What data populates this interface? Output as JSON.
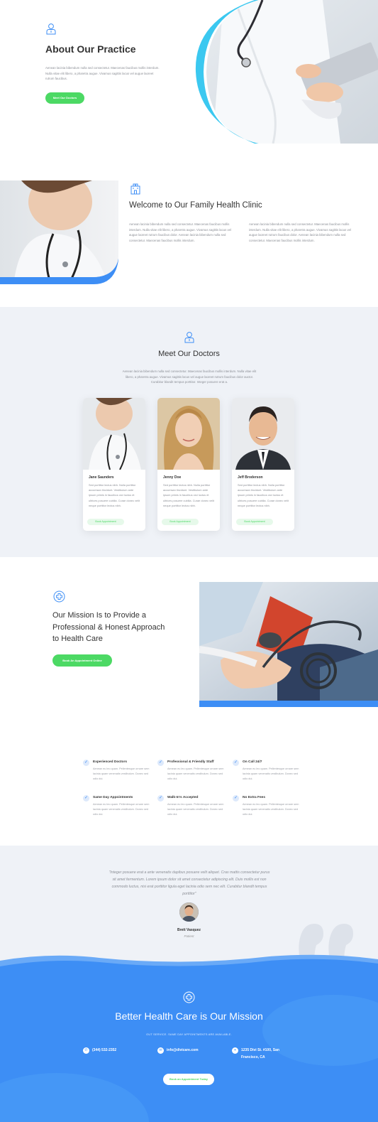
{
  "about": {
    "title": "About Our Practice",
    "text": "Aenean lacinia bibendum nulla sed consectetur. Maecenas faucibus mollis interdum. Nulla vitae elit libero, a pharetra augue. Vivamus sagittis lacus vel augue laoreet rutrum faucibus.",
    "button": "Meet Our Doctors",
    "icon": "doctor-icon"
  },
  "welcome": {
    "title": "Welcome to Our Family Health Clinic",
    "col1": "Aenean lacinia bibendum nulla sed consectetur. Maecenas faucibus mollis interdum. Nulla vitae elit libero, a pharetra augue. Vivamus sagittis lacus vel augue laoreet rutrum faucibus dolor. Aenean lacinia bibendum nulla sed consectetur. Maecenas faucibus mollis interdum.",
    "col2": "Aenean lacinia bibendum nulla sed consectetur. Maecenas faucibus mollis interdum. Nulla vitae elit libero, a pharetra augue. Vivamus sagittis lacus vel augue laoreet rutrum faucibus dolor. Aenean lacinia bibendum nulla sed consectetur. Maecenas faucibus mollis interdum.",
    "icon": "hospital-icon"
  },
  "doctors": {
    "title": "Meet Our Doctors",
    "intro": "Aenean lacinia bibendum nulla sed consectetur. Maecenas faucibus mollis interdum. Nulla vitae elit libero, a pharetra augue. Vivamus sagittis lacus vel augue laoreet rutrum faucibus dolor auctor. Curabitur blandit tempus porttitor. Integer posuere erat a.",
    "cards": [
      {
        "name": "Jane Saunders",
        "bio": "Sed porttitor lectus nibh. Nulla porttitor accumsan tincidunt. Vestibulum ante ipsum primis in faucibus orci luctus et ultrices posuere cubilia. Curae donec velit neque porttitor lectus nibh.",
        "button": "Book Appointment"
      },
      {
        "name": "Jenny Doe",
        "bio": "Sed porttitor lectus nibh. Nulla porttitor accumsan tincidunt. Vestibulum ante ipsum primis in faucibus orci luctus et ultrices posuere cubilia. Curae donec velit neque porttitor lectus nibh.",
        "button": "Book Appointment"
      },
      {
        "name": "Jeff Broderson",
        "bio": "Sed porttitor lectus nibh. Nulla porttitor accumsan tincidunt. Vestibulum ante ipsum primis in faucibus orci luctus et ultrices posuere cubilia. Curae donec velit neque porttitor lectus nibh.",
        "button": "Book Appointment"
      }
    ]
  },
  "mission": {
    "title": "Our Mission Is to Provide a Professional & Honest Approach to Health Care",
    "button": "Book An Appointment Online",
    "icon": "medical-cross-icon"
  },
  "features": [
    {
      "title": "Experienced Doctors",
      "text": "Aenean eu leo quam. Pellentesque ornare sem lacinia quam venenatis vestibulum. Donec sed odio dui."
    },
    {
      "title": "Professional & Friendly Staff",
      "text": "Aenean eu leo quam. Pellentesque ornare sem lacinia quam venenatis vestibulum. Donec sed odio dui."
    },
    {
      "title": "On Call 24/7",
      "text": "Aenean eu leo quam. Pellentesque ornare sem lacinia quam venenatis vestibulum. Donec sed odio dui."
    },
    {
      "title": "Same Day Appointments",
      "text": "Aenean eu leo quam. Pellentesque ornare sem lacinia quam venenatis vestibulum. Donec sed odio dui."
    },
    {
      "title": "Walk-In's Accepted",
      "text": "Aenean eu leo quam. Pellentesque ornare sem lacinia quam venenatis vestibulum. Donec sed odio dui."
    },
    {
      "title": "No Extra Fees",
      "text": "Aenean eu leo quam. Pellentesque ornare sem lacinia quam venenatis vestibulum. Donec sed odio dui."
    }
  ],
  "testimonial": {
    "quote": "\"Integer posuere erat a ante venenatis dapibus posuere velit aliquet. Cras mattis consectetur purus sit amet fermentum. Lorem ipsum dolor sit amet consectetur adipiscing elit. Duis mollis est non commodo luctus, nisi erat porttitor ligula eget lacinia odio sem nec elit. Curabitur blandit tempus porttitor\"",
    "name": "Brett Vasquez",
    "role": "Patient"
  },
  "cta": {
    "title": "Better Health Care is Our Mission",
    "subtitle": "OUT SERVICE. SAME DAY APPOINTMENTS ARE AVAILABLE.",
    "phone": "(344) 532-2352",
    "email": "info@divicare.com",
    "address": "1235 Divi St. #100, San Francisco, CA",
    "button": "Book an Appointment Today"
  },
  "colors": {
    "accent_blue": "#3d8ef5",
    "accent_green": "#4cd964",
    "light_bg": "#eff2f7"
  }
}
